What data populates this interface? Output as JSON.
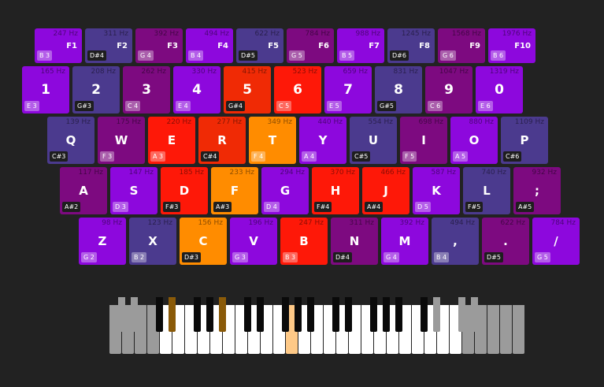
{
  "keyboard": {
    "fn_row": [
      {
        "hz": "247 Hz",
        "key": "F1",
        "note": "B 3",
        "color": "#8d08dd",
        "note_style": "light"
      },
      {
        "hz": "311 Hz",
        "key": "F2",
        "note": "D#4",
        "color": "#4b3a8e",
        "note_style": "dark"
      },
      {
        "hz": "392 Hz",
        "key": "F3",
        "note": "G 4",
        "color": "#7d0a80",
        "note_style": "light"
      },
      {
        "hz": "494 Hz",
        "key": "F4",
        "note": "B 4",
        "color": "#8d08dd",
        "note_style": "light"
      },
      {
        "hz": "622 Hz",
        "key": "F5",
        "note": "D#5",
        "color": "#4b3a8e",
        "note_style": "dark"
      },
      {
        "hz": "784 Hz",
        "key": "F6",
        "note": "G 5",
        "color": "#7d0a80",
        "note_style": "light"
      },
      {
        "hz": "988 Hz",
        "key": "F7",
        "note": "B 5",
        "color": "#8d08dd",
        "note_style": "light"
      },
      {
        "hz": "1245 Hz",
        "key": "F8",
        "note": "D#6",
        "color": "#4b3a8e",
        "note_style": "dark"
      },
      {
        "hz": "1568 Hz",
        "key": "F9",
        "note": "G 6",
        "color": "#7d0a80",
        "note_style": "light"
      },
      {
        "hz": "1976 Hz",
        "key": "F10",
        "note": "B 6",
        "color": "#8d08dd",
        "note_style": "light"
      }
    ],
    "num_row": [
      {
        "hz": "165 Hz",
        "key": "1",
        "note": "E 3",
        "color": "#8d08dd",
        "note_style": "light"
      },
      {
        "hz": "208 Hz",
        "key": "2",
        "note": "G#3",
        "color": "#4b3a8e",
        "note_style": "dark"
      },
      {
        "hz": "262 Hz",
        "key": "3",
        "note": "C 4",
        "color": "#7d0a80",
        "note_style": "light"
      },
      {
        "hz": "330 Hz",
        "key": "4",
        "note": "E 4",
        "color": "#8d08dd",
        "note_style": "light"
      },
      {
        "hz": "415 Hz",
        "key": "5",
        "note": "G#4",
        "color": "#f02a05",
        "note_style": "dark"
      },
      {
        "hz": "523 Hz",
        "key": "6",
        "note": "C 5",
        "color": "#fe1808",
        "note_style": "light"
      },
      {
        "hz": "659 Hz",
        "key": "7",
        "note": "E 5",
        "color": "#8d08dd",
        "note_style": "light"
      },
      {
        "hz": "831 Hz",
        "key": "8",
        "note": "G#5",
        "color": "#4b3a8e",
        "note_style": "dark"
      },
      {
        "hz": "1047 Hz",
        "key": "9",
        "note": "C 6",
        "color": "#7d0a80",
        "note_style": "light"
      },
      {
        "hz": "1319 Hz",
        "key": "0",
        "note": "E 6",
        "color": "#8d08dd",
        "note_style": "light"
      }
    ],
    "q_row": [
      {
        "hz": "139 Hz",
        "key": "Q",
        "note": "C#3",
        "color": "#4b3a8e",
        "note_style": "dark"
      },
      {
        "hz": "175 Hz",
        "key": "W",
        "note": "F 3",
        "color": "#7d0a80",
        "note_style": "light"
      },
      {
        "hz": "220 Hz",
        "key": "E",
        "note": "A 3",
        "color": "#fe1808",
        "note_style": "light"
      },
      {
        "hz": "277 Hz",
        "key": "R",
        "note": "C#4",
        "color": "#f02a05",
        "note_style": "dark"
      },
      {
        "hz": "349 Hz",
        "key": "T",
        "note": "F 4",
        "color": "#ff8c00",
        "note_style": "light"
      },
      {
        "hz": "440 Hz",
        "key": "Y",
        "note": "A 4",
        "color": "#8d08dd",
        "note_style": "light"
      },
      {
        "hz": "554 Hz",
        "key": "U",
        "note": "C#5",
        "color": "#4b3a8e",
        "note_style": "dark"
      },
      {
        "hz": "698 Hz",
        "key": "I",
        "note": "F 5",
        "color": "#7d0a80",
        "note_style": "light"
      },
      {
        "hz": "880 Hz",
        "key": "O",
        "note": "A 5",
        "color": "#8d08dd",
        "note_style": "light"
      },
      {
        "hz": "1109 Hz",
        "key": "P",
        "note": "C#6",
        "color": "#4b3a8e",
        "note_style": "dark"
      }
    ],
    "a_row": [
      {
        "hz": "117 Hz",
        "key": "A",
        "note": "A#2",
        "color": "#7d0a80",
        "note_style": "dark"
      },
      {
        "hz": "147 Hz",
        "key": "S",
        "note": "D 3",
        "color": "#8d08dd",
        "note_style": "light"
      },
      {
        "hz": "185 Hz",
        "key": "D",
        "note": "F#3",
        "color": "#fe1808",
        "note_style": "dark"
      },
      {
        "hz": "233 Hz",
        "key": "F",
        "note": "A#3",
        "color": "#ff8c00",
        "note_style": "dark"
      },
      {
        "hz": "294 Hz",
        "key": "G",
        "note": "D 4",
        "color": "#8d08dd",
        "note_style": "light"
      },
      {
        "hz": "370 Hz",
        "key": "H",
        "note": "F#4",
        "color": "#fe1808",
        "note_style": "dark"
      },
      {
        "hz": "466 Hz",
        "key": "J",
        "note": "A#4",
        "color": "#fe1808",
        "note_style": "dark"
      },
      {
        "hz": "587 Hz",
        "key": "K",
        "note": "D 5",
        "color": "#8d08dd",
        "note_style": "light"
      },
      {
        "hz": "740 Hz",
        "key": "L",
        "note": "F#5",
        "color": "#4b3a8e",
        "note_style": "dark"
      },
      {
        "hz": "932 Hz",
        "key": ";",
        "note": "A#5",
        "color": "#7d0a80",
        "note_style": "dark"
      }
    ],
    "z_row": [
      {
        "hz": "98 Hz",
        "key": "Z",
        "note": "G 2",
        "color": "#8d08dd",
        "note_style": "light"
      },
      {
        "hz": "123 Hz",
        "key": "X",
        "note": "B 2",
        "color": "#4b3a8e",
        "note_style": "light"
      },
      {
        "hz": "156 Hz",
        "key": "C",
        "note": "D#3",
        "color": "#ff8c00",
        "note_style": "dark"
      },
      {
        "hz": "196 Hz",
        "key": "V",
        "note": "G 3",
        "color": "#8d08dd",
        "note_style": "light"
      },
      {
        "hz": "247 Hz",
        "key": "B",
        "note": "B 3",
        "color": "#fe1808",
        "note_style": "light"
      },
      {
        "hz": "311 Hz",
        "key": "N",
        "note": "D#4",
        "color": "#7d0a80",
        "note_style": "dark"
      },
      {
        "hz": "392 Hz",
        "key": "M",
        "note": "G 4",
        "color": "#8d08dd",
        "note_style": "light"
      },
      {
        "hz": "494 Hz",
        "key": ",",
        "note": "B 4",
        "color": "#4b3a8e",
        "note_style": "light"
      },
      {
        "hz": "622 Hz",
        "key": ".",
        "note": "D#5",
        "color": "#7d0a80",
        "note_style": "dark"
      },
      {
        "hz": "784 Hz",
        "key": "/",
        "note": "G 5",
        "color": "#8d08dd",
        "note_style": "light"
      }
    ]
  },
  "piano": {
    "colors": {
      "white": "#ffffff",
      "black": "#0a0a0a",
      "out_of_range": "#9b9b9b",
      "highlight_white": "#fec987",
      "highlight_black": "#8a5a08"
    },
    "white_keys": [
      "out",
      "out",
      "out",
      "out",
      "in",
      "in",
      "in",
      "in",
      "in",
      "in",
      "in",
      "in",
      "in",
      "in",
      "hl",
      "in",
      "in",
      "in",
      "in",
      "in",
      "in",
      "in",
      "in",
      "in",
      "in",
      "in",
      "in",
      "in",
      "out",
      "out",
      "out",
      "out",
      "out"
    ],
    "black_keys": [
      "out",
      "out",
      "in",
      "hl",
      "in",
      "in",
      "hl",
      "in",
      "in",
      "in",
      "in",
      "in",
      "in",
      "in",
      "in",
      "in",
      "in",
      "in",
      "out",
      "out",
      "out"
    ]
  }
}
